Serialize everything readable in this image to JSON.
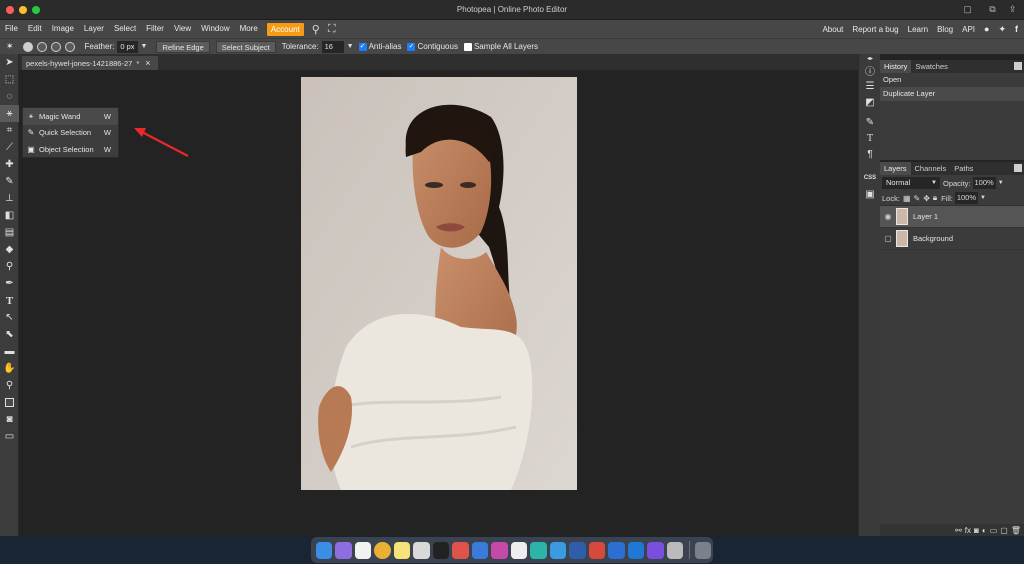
{
  "window": {
    "title": "Photopea | Online Photo Editor",
    "traffic_lights": [
      "#ff5f57",
      "#febc2e",
      "#28c840"
    ]
  },
  "menu": {
    "items": [
      "File",
      "Edit",
      "Image",
      "Layer",
      "Select",
      "Filter",
      "View",
      "Window",
      "More"
    ],
    "account": "Account",
    "right": [
      "About",
      "Report a bug",
      "Learn",
      "Blog",
      "API"
    ]
  },
  "options": {
    "feather_label": "Feather:",
    "feather_value": "0 px",
    "refine_edge": "Refine Edge",
    "select_subject": "Select Subject",
    "tolerance_label": "Tolerance:",
    "tolerance_value": "16",
    "anti_alias": "Anti-alias",
    "contiguous": "Contiguous",
    "sample_all_layers": "Sample All Layers"
  },
  "document": {
    "tab_name": "pexels-hywel-jones-1421886-27",
    "tab_modified": "*",
    "tab_close": "×"
  },
  "flyout": {
    "items": [
      {
        "label": "Magic Wand",
        "key": "W",
        "icon": "magic-wand-icon"
      },
      {
        "label": "Quick Selection",
        "key": "W",
        "icon": "quick-selection-icon"
      },
      {
        "label": "Object Selection",
        "key": "W",
        "icon": "object-selection-icon"
      }
    ]
  },
  "history": {
    "tabs": [
      "History",
      "Swatches"
    ],
    "items": [
      "Open",
      "Duplicate Layer"
    ]
  },
  "layers": {
    "tabs": [
      "Layers",
      "Channels",
      "Paths"
    ],
    "blend_mode": "Normal",
    "opacity_label": "Opacity:",
    "opacity_value": "100%",
    "lock_label": "Lock:",
    "fill_label": "Fill:",
    "fill_value": "100%",
    "items": [
      {
        "name": "Layer 1",
        "visible": true,
        "selected": true
      },
      {
        "name": "Background",
        "visible": false,
        "selected": false
      }
    ]
  },
  "right_strip": {
    "labels": [
      "CSS"
    ]
  },
  "colors": {
    "accent": "#f59b18",
    "arrow": "#e8282b"
  }
}
